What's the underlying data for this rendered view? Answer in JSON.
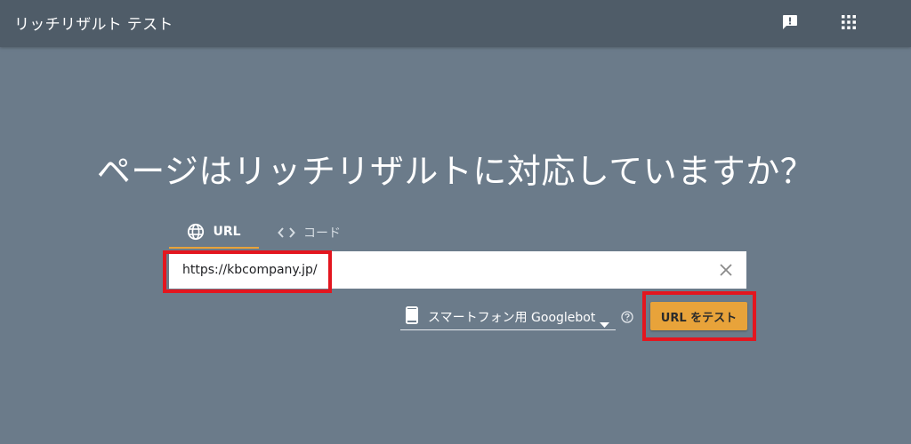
{
  "app": {
    "title": "リッチリザルト テスト"
  },
  "topbar": {
    "icons": [
      "feedback-icon",
      "apps-grid-icon"
    ]
  },
  "main": {
    "headline": "ページはリッチリザルトに対応していますか？",
    "tabs": [
      {
        "label": "URL",
        "icon": "globe-icon",
        "active": true
      },
      {
        "label": "コード",
        "icon": "code-brackets-icon",
        "active": false
      }
    ],
    "url_input": {
      "value": "https://kbcompany.jp/",
      "clear_icon": "close-icon"
    },
    "user_agent": {
      "selected": "スマートフォン用 Googlebot",
      "icon": "smartphone-icon"
    },
    "help_icon": "help-circle-icon",
    "test_button": "URL をテスト"
  },
  "colors": {
    "background": "#6b7b8a",
    "topbar": "#4f5c68",
    "accent": "#e8a33a",
    "highlight_box": "#e3161f"
  }
}
